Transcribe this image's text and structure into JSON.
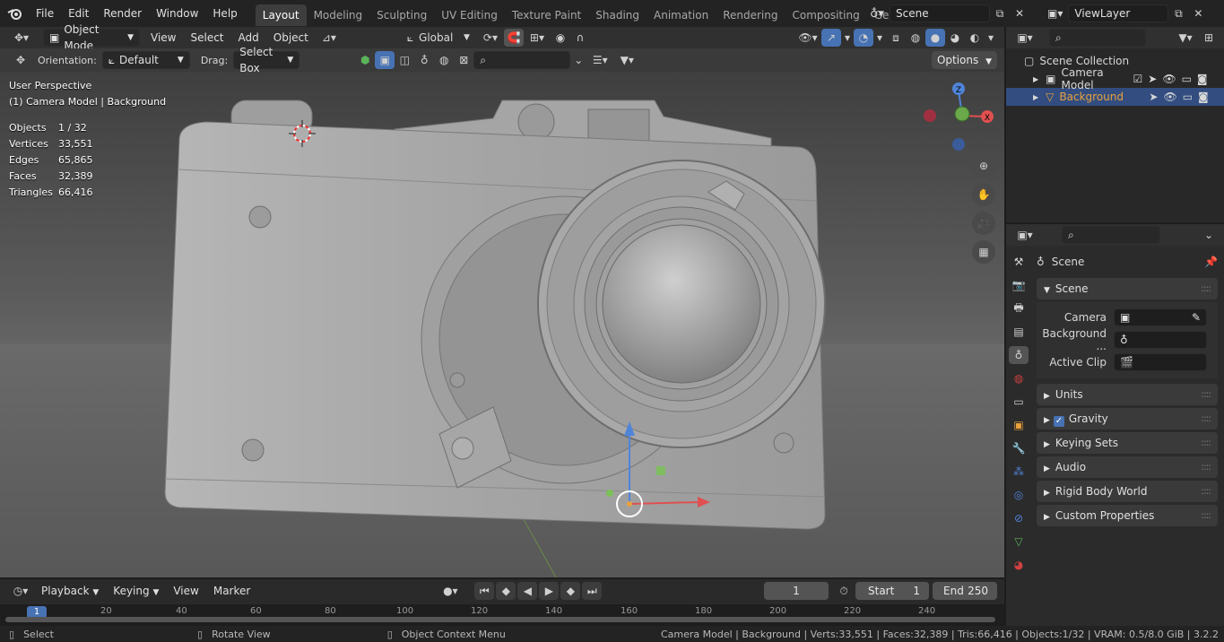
{
  "top_menu": [
    "File",
    "Edit",
    "Render",
    "Window",
    "Help"
  ],
  "workspaces": [
    "Layout",
    "Modeling",
    "Sculpting",
    "UV Editing",
    "Texture Paint",
    "Shading",
    "Animation",
    "Rendering",
    "Compositing",
    "Geometry Noc"
  ],
  "scene_name": "Scene",
  "view_layer": "ViewLayer",
  "header": {
    "mode": "Object Mode",
    "menus": [
      "View",
      "Select",
      "Add",
      "Object"
    ],
    "transform": "Global"
  },
  "tool_settings": {
    "orientation_label": "Orientation:",
    "orientation_value": "Default",
    "drag_label": "Drag:",
    "drag_value": "Select Box",
    "options": "Options"
  },
  "viewport": {
    "perspective": "User Perspective",
    "context": "(1) Camera Model | Background",
    "stats": [
      {
        "label": "Objects",
        "value": "1 / 32"
      },
      {
        "label": "Vertices",
        "value": "33,551"
      },
      {
        "label": "Edges",
        "value": "65,865"
      },
      {
        "label": "Faces",
        "value": "32,389"
      },
      {
        "label": "Triangles",
        "value": "66,416"
      }
    ],
    "gizmo": {
      "z": "Z",
      "x": "X"
    }
  },
  "outliner": {
    "root": "Scene Collection",
    "items": [
      {
        "label": "Camera Model",
        "selected": false
      },
      {
        "label": "Background",
        "selected": true
      }
    ]
  },
  "properties": {
    "breadcrumb": "Scene",
    "section_scene": "Scene",
    "fields": [
      {
        "label": "Camera"
      },
      {
        "label": "Background ..."
      },
      {
        "label": "Active Clip"
      }
    ],
    "panels": [
      "Units",
      "Gravity",
      "Keying Sets",
      "Audio",
      "Rigid Body World",
      "Custom Properties"
    ],
    "gravity_checked": true
  },
  "timeline": {
    "menus": [
      "Playback",
      "Keying",
      "View",
      "Marker"
    ],
    "current_frame": "1",
    "start_label": "Start",
    "start": "1",
    "end_label": "End",
    "end": "250",
    "ruler": [
      "1",
      "20",
      "40",
      "60",
      "80",
      "100",
      "120",
      "140",
      "160",
      "180",
      "200",
      "220",
      "240"
    ]
  },
  "status": {
    "select": "Select",
    "rotate": "Rotate View",
    "context": "Object Context Menu",
    "info": "Camera Model | Background | Verts:33,551 | Faces:32,389 | Tris:66,416 | Objects:1/32 | VRAM: 0.5/8.0 GiB | 3.2.2"
  },
  "colors": {
    "accent": "#4772b3",
    "selected_row": "#334d80",
    "background_orange": "#e8a13c"
  }
}
